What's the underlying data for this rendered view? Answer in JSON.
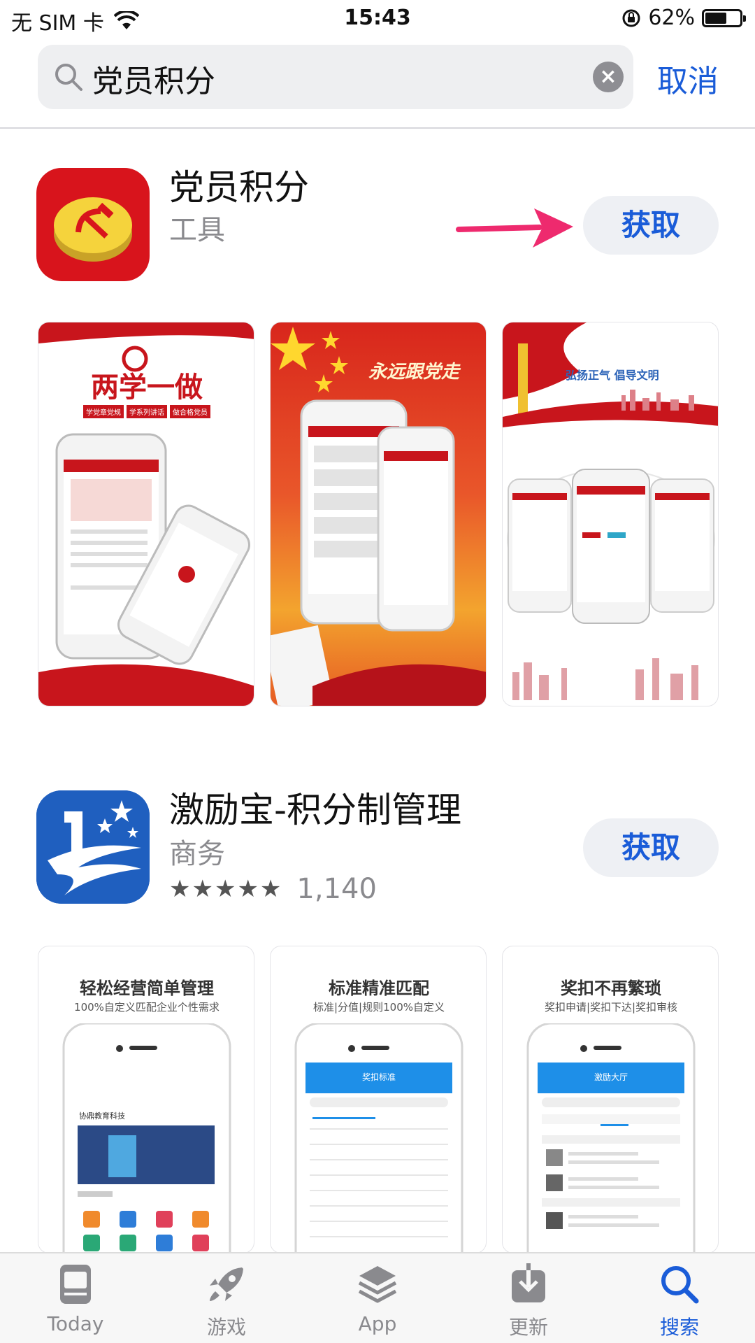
{
  "status_bar": {
    "carrier": "无 SIM 卡",
    "time": "15:43",
    "battery": "62%",
    "battery_level": 0.62
  },
  "search": {
    "query": "党员积分",
    "cancel_label": "取消"
  },
  "results": [
    {
      "title": "党员积分",
      "category": "工具",
      "get_label": "获取",
      "screenshots": [
        {
          "headline": "两学一做",
          "tags": [
            "学党章党规",
            "学系列讲话",
            "做合格党员"
          ]
        },
        {
          "headline": "永远跟党走"
        },
        {
          "headline": "弘扬正气 倡导文明"
        }
      ]
    },
    {
      "title": "激励宝-积分制管理",
      "category": "商务",
      "get_label": "获取",
      "rating_stars": 5,
      "rating_count": "1,140",
      "screenshots": [
        {
          "headline": "轻松经营简单管理",
          "sub": "100%自定义匹配企业个性需求",
          "screen_title": "协鼎教育科技"
        },
        {
          "headline": "标准精准匹配",
          "sub": "标准|分值|规则100%自定义",
          "screen_title": "奖扣标准"
        },
        {
          "headline": "奖扣不再繁琐",
          "sub": "奖扣申请|奖扣下达|奖扣审核",
          "screen_title": "激励大厅"
        }
      ]
    }
  ],
  "tab_bar": {
    "items": [
      {
        "label": "Today",
        "icon": "today-icon"
      },
      {
        "label": "游戏",
        "icon": "rocket-icon"
      },
      {
        "label": "App",
        "icon": "layers-icon"
      },
      {
        "label": "更新",
        "icon": "download-icon"
      },
      {
        "label": "搜索",
        "icon": "search-icon"
      }
    ],
    "active": "搜索"
  },
  "colors": {
    "accent": "#1a5cd8",
    "party_red": "#d8141c",
    "gold": "#f5d33c",
    "app2_blue": "#1f5fbf"
  }
}
